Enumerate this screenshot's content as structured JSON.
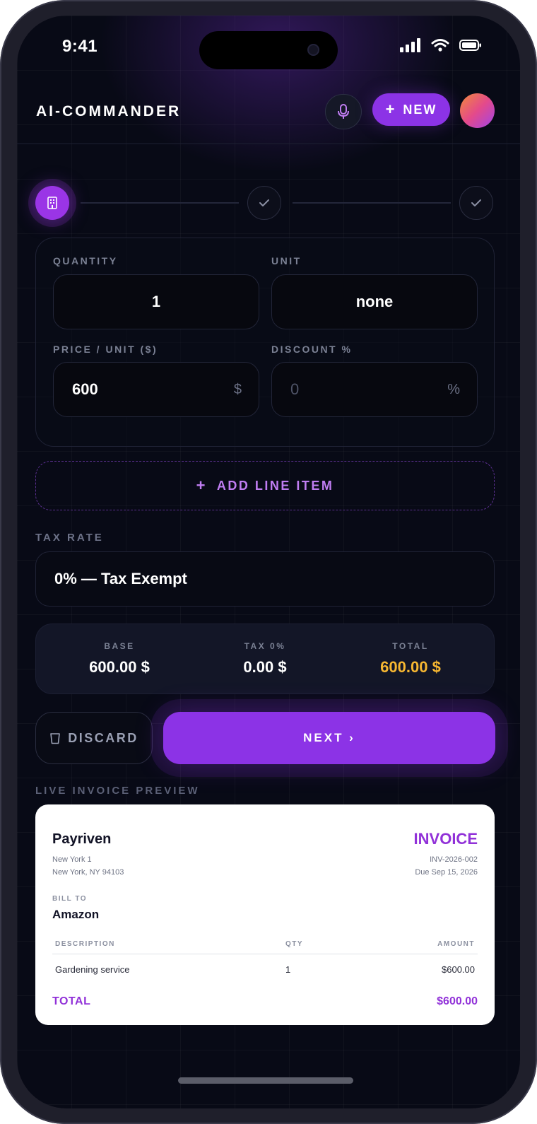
{
  "status_bar": {
    "time": "9:41"
  },
  "header": {
    "brand": "AI-COMMANDER",
    "new_label": "NEW"
  },
  "form": {
    "quantity_label": "QUANTITY",
    "quantity_value": "1",
    "unit_label": "UNIT",
    "unit_value": "none",
    "price_label": "PRICE / UNIT ($)",
    "price_value": "600",
    "price_suffix": "$",
    "discount_label": "DISCOUNT %",
    "discount_placeholder": "0",
    "discount_suffix": "%"
  },
  "add_line_item_label": "ADD LINE ITEM",
  "tax": {
    "label": "TAX RATE",
    "value": "0% — Tax Exempt"
  },
  "totals": {
    "base_label": "BASE",
    "base_value": "600.00 $",
    "tax_label": "TAX 0%",
    "tax_value": "0.00 $",
    "total_label": "TOTAL",
    "total_value": "600.00 $"
  },
  "actions": {
    "discard_label": "DISCARD",
    "next_label": "NEXT ›"
  },
  "preview": {
    "label": "LIVE INVOICE PREVIEW",
    "company": "Payriven",
    "address_line1": "New York 1",
    "address_line2": "New York, NY 94103",
    "title": "INVOICE",
    "number": "INV-2026-002",
    "due": "Due Sep 15, 2026",
    "bill_to_label": "BILL TO",
    "bill_to_name": "Amazon",
    "columns": {
      "description": "DESCRIPTION",
      "qty": "QTY",
      "amount": "AMOUNT"
    },
    "rows": [
      {
        "description": "Gardening service",
        "qty": "1",
        "amount": "$600.00"
      }
    ],
    "total_label": "TOTAL",
    "total_value": "$600.00"
  },
  "colors": {
    "accent": "#8c33e6",
    "gold": "#f7b731",
    "background": "#080a16"
  }
}
